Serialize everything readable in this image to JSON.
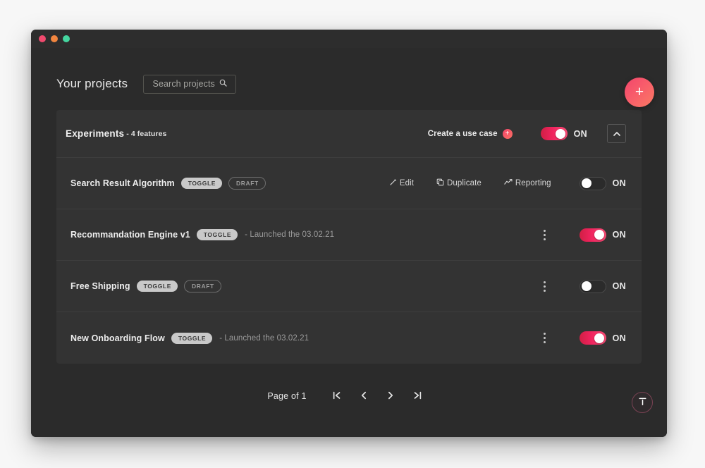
{
  "window": {
    "traffic_lights": [
      "close",
      "minimize",
      "maximize"
    ]
  },
  "header": {
    "title": "Your projects",
    "search": {
      "placeholder": "Search projects",
      "icon": "search-icon"
    },
    "add_button": {
      "icon": "plus-icon",
      "label": "+",
      "color": "#f2456b"
    }
  },
  "project": {
    "name": "Experiments",
    "features_count_label": "- 4 features",
    "create_use_case": {
      "label": "Create a use case",
      "icon": "plus-circle-icon"
    },
    "master_toggle": {
      "state": "on",
      "label": "ON"
    },
    "collapse_button": {
      "icon": "chevron-up-icon"
    }
  },
  "features": [
    {
      "name": "Search Result Algorithm",
      "badges": [
        {
          "text": "TOGGLE",
          "style": "solid"
        },
        {
          "text": "DRAFT",
          "style": "outline"
        }
      ],
      "launch_note": "",
      "actions": [
        {
          "label": "Edit",
          "icon": "pencil-icon"
        },
        {
          "label": "Duplicate",
          "icon": "copy-icon"
        },
        {
          "label": "Reporting",
          "icon": "trending-up-icon"
        }
      ],
      "menu_icon": "",
      "toggle": {
        "state": "off",
        "label": "ON"
      }
    },
    {
      "name": "Recommandation Engine v1",
      "badges": [
        {
          "text": "TOGGLE",
          "style": "solid"
        }
      ],
      "launch_note": "- Launched the 03.02.21",
      "actions": [],
      "menu_icon": "kebab-menu-icon",
      "toggle": {
        "state": "on",
        "label": "ON"
      }
    },
    {
      "name": "Free Shipping",
      "badges": [
        {
          "text": "TOGGLE",
          "style": "solid"
        },
        {
          "text": "DRAFT",
          "style": "outline"
        }
      ],
      "launch_note": "",
      "actions": [],
      "menu_icon": "kebab-menu-icon",
      "toggle": {
        "state": "off",
        "label": "ON"
      }
    },
    {
      "name": "New Onboarding Flow",
      "badges": [
        {
          "text": "TOGGLE",
          "style": "solid"
        }
      ],
      "launch_note": "- Launched the 03.02.21",
      "actions": [],
      "menu_icon": "kebab-menu-icon",
      "toggle": {
        "state": "on",
        "label": "ON"
      }
    }
  ],
  "pagination": {
    "page_label": "Page of 1",
    "buttons": [
      {
        "name": "first-page",
        "icon": "first-page-icon"
      },
      {
        "name": "previous-page",
        "icon": "chevron-left-icon"
      },
      {
        "name": "next-page",
        "icon": "chevron-right-icon"
      },
      {
        "name": "last-page",
        "icon": "last-page-icon"
      }
    ]
  },
  "scroll_top_button": {
    "icon": "scroll-to-top-icon"
  },
  "colors": {
    "accent": "#f2456b",
    "window_bg": "#2b2b2b",
    "card_bg": "#333333",
    "text": "#ededed"
  }
}
